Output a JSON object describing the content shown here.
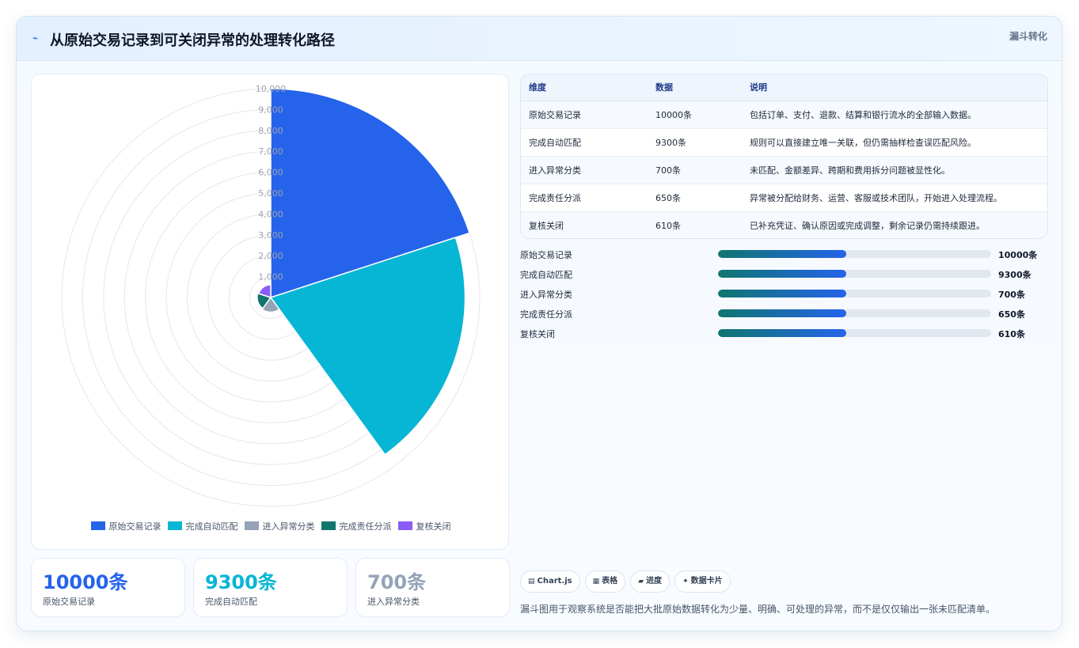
{
  "header": {
    "icon": "chart-line-icon",
    "title": "从原始交易记录到可关闭异常的处理转化路径",
    "tag": "漏斗转化"
  },
  "chart_data": {
    "type": "polarArea",
    "categories": [
      "原始交易记录",
      "完成自动匹配",
      "进入异常分类",
      "完成责任分派",
      "复核关闭"
    ],
    "values": [
      10000,
      9300,
      700,
      650,
      610
    ],
    "colors": [
      "#2563eb",
      "#06b6d4",
      "#94a3b8",
      "#0f766e",
      "#8b5cf6"
    ],
    "rlim": [
      0,
      10000
    ],
    "ticks": [
      "1,000",
      "2,000",
      "3,000",
      "4,000",
      "5,000",
      "6,000",
      "7,000",
      "8,000",
      "9,000",
      "10,000"
    ],
    "legend": "bottom",
    "grid": true
  },
  "stats": [
    {
      "value": "10000条",
      "label": "原始交易记录",
      "color": "#2563eb"
    },
    {
      "value": "9300条",
      "label": "完成自动匹配",
      "color": "#06b6d4"
    },
    {
      "value": "700条",
      "label": "进入异常分类",
      "color": "#94a3b8"
    }
  ],
  "table": {
    "headers": [
      "维度",
      "数据",
      "说明"
    ],
    "rows": [
      [
        "原始交易记录",
        "10000条",
        "包括订单、支付、退款、结算和银行流水的全部输入数据。"
      ],
      [
        "完成自动匹配",
        "9300条",
        "规则可以直接建立唯一关联，但仍需抽样检查误匹配风险。"
      ],
      [
        "进入异常分类",
        "700条",
        "未匹配、金额差异、跨期和费用拆分问题被显性化。"
      ],
      [
        "完成责任分派",
        "650条",
        "异常被分配给财务、运营、客服或技术团队，开始进入处理流程。"
      ],
      [
        "复核关闭",
        "610条",
        "已补充凭证、确认原因或完成调整，剩余记录仍需持续跟进。"
      ]
    ]
  },
  "progress": [
    {
      "label": "原始交易记录",
      "value": "10000条",
      "fill": 0.47
    },
    {
      "label": "完成自动匹配",
      "value": "9300条",
      "fill": 0.47
    },
    {
      "label": "进入异常分类",
      "value": "700条",
      "fill": 0.47
    },
    {
      "label": "完成责任分派",
      "value": "650条",
      "fill": 0.47
    },
    {
      "label": "复核关闭",
      "value": "610条",
      "fill": 0.47
    }
  ],
  "pills": [
    {
      "icon": "chart-icon",
      "glyph": "▤",
      "label": "Chart.js"
    },
    {
      "icon": "table-icon",
      "glyph": "▦",
      "label": "表格"
    },
    {
      "icon": "progress-icon",
      "glyph": "▰",
      "label": "进度"
    },
    {
      "icon": "sparkle-icon",
      "glyph": "✦",
      "label": "数据卡片"
    }
  ],
  "footnote": "漏斗图用于观察系统是否能把大批原始数据转化为少量、明确、可处理的异常，而不是仅仅输出一张未匹配清单。"
}
